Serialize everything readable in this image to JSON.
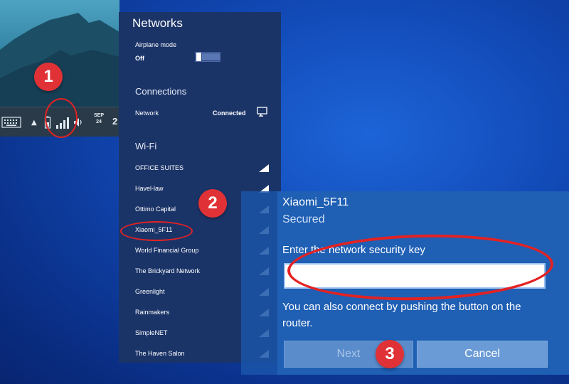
{
  "taskbar": {
    "clock_line1": "SEP",
    "clock_line2": "24",
    "day": "2",
    "icons": [
      "keyboard-icon",
      "chevron-up-icon",
      "battery-icon",
      "wifi-signal-icon",
      "volume-icon"
    ]
  },
  "steps": [
    "1",
    "2",
    "3"
  ],
  "networks": {
    "title": "Networks",
    "airplane_label": "Airplane mode",
    "airplane_state": "Off",
    "connections_heading": "Connections",
    "connection": {
      "name": "Network",
      "status": "Connected"
    },
    "wifi_heading": "Wi-Fi",
    "wifi_list": [
      "OFFICE SUITES",
      "Havel-law",
      "Ottimo Capital",
      "Xiaomi_5F11",
      "World Financial Group",
      "The Brickyard Network",
      "Greenlight",
      "Rainmakers",
      "SimpleNET",
      "The Haven Salon"
    ]
  },
  "dialog": {
    "network_name": "Xiaomi_5F11",
    "security": "Secured",
    "prompt": "Enter the network security key",
    "key_value": "",
    "hint": "You can also connect by pushing the button on the router.",
    "next_label": "Next",
    "cancel_label": "Cancel"
  },
  "colors": {
    "highlight_red": "#e32223",
    "badge_red": "#e03236",
    "flyout_bg": "#1b3468",
    "dialog_bg": "#1f5fb4"
  }
}
